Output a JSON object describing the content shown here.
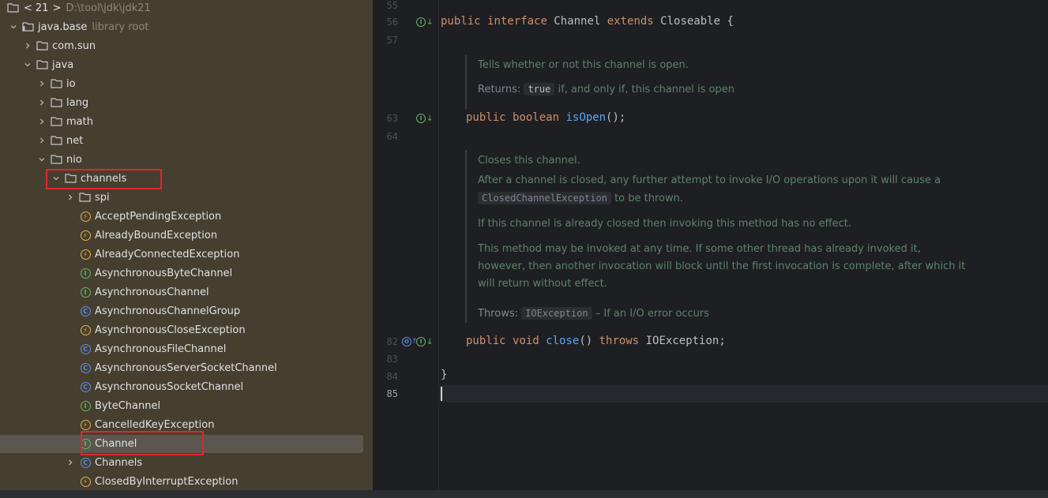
{
  "project_tree": {
    "header": {
      "back": "<",
      "version": "21",
      "sep": ">",
      "path": "D:\\tool\\jdk\\jdk21"
    },
    "nodes": [
      {
        "label": "java.base",
        "hint": "library root",
        "kind": "library"
      },
      {
        "label": "com.sun",
        "kind": "package"
      },
      {
        "label": "java",
        "kind": "package"
      },
      {
        "label": "io",
        "kind": "package"
      },
      {
        "label": "lang",
        "kind": "package"
      },
      {
        "label": "math",
        "kind": "package"
      },
      {
        "label": "net",
        "kind": "package"
      },
      {
        "label": "nio",
        "kind": "package"
      },
      {
        "label": "channels",
        "kind": "package",
        "highlighted": true
      },
      {
        "label": "spi",
        "kind": "package"
      },
      {
        "label": "AcceptPendingException",
        "kind": "exception"
      },
      {
        "label": "AlreadyBoundException",
        "kind": "exception"
      },
      {
        "label": "AlreadyConnectedException",
        "kind": "exception"
      },
      {
        "label": "AsynchronousByteChannel",
        "kind": "interface"
      },
      {
        "label": "AsynchronousChannel",
        "kind": "interface"
      },
      {
        "label": "AsynchronousChannelGroup",
        "kind": "class"
      },
      {
        "label": "AsynchronousCloseException",
        "kind": "exception"
      },
      {
        "label": "AsynchronousFileChannel",
        "kind": "class"
      },
      {
        "label": "AsynchronousServerSocketChannel",
        "kind": "class"
      },
      {
        "label": "AsynchronousSocketChannel",
        "kind": "class"
      },
      {
        "label": "ByteChannel",
        "kind": "interface"
      },
      {
        "label": "CancelledKeyException",
        "kind": "exception"
      },
      {
        "label": "Channel",
        "kind": "interface",
        "selected": true,
        "highlighted": true
      },
      {
        "label": "Channels",
        "kind": "class"
      },
      {
        "label": "ClosedByInterruptException",
        "kind": "exception"
      }
    ]
  },
  "editor": {
    "line_numbers": [
      "55",
      "56",
      "57",
      "63",
      "64",
      "82",
      "83",
      "84",
      "85"
    ],
    "code": {
      "l56_kw1": "public",
      "l56_kw2": "interface",
      "l56_name": " Channel ",
      "l56_kw3": "extends",
      "l56_rest": " Closeable {",
      "l63_kw1": "public",
      "l63_kw2": "boolean",
      "l63_fn": "isOpen",
      "l63_rest": "();",
      "l82_kw1": "public",
      "l82_kw2": "void",
      "l82_fn": "close",
      "l82_mid": "() ",
      "l82_kw3": "throws",
      "l82_rest": " IOException;",
      "l84": "}"
    },
    "doc_isopen": {
      "summary": "Tells whether or not this channel is open.",
      "returns_label": "Returns:",
      "returns_code": "true",
      "returns_text": " if, and only if, this channel is open"
    },
    "doc_close": {
      "summary": "Closes this channel.",
      "p1_text": "After a channel is closed, any further attempt to invoke I/O operations upon it will cause a",
      "p1_code": "ClosedChannelException",
      "p1_tail": " to be thrown.",
      "p2": "If this channel is already closed then invoking this method has no effect.",
      "p3": "This method may be invoked at any time. If some other thread has already invoked it, however, then another invocation will block until the first invocation is complete, after which it will return without effect.",
      "throws_label": "Throws:",
      "throws_code": "IOException",
      "throws_text": " – If an I/O error occurs"
    }
  },
  "colors": {
    "sidebar_bg": "#463f2f",
    "editor_bg": "#1e1f22",
    "keyword": "#cf8e6d",
    "function": "#56a8f5",
    "doc_text": "#5f826b",
    "highlight_box": "#e0262e"
  }
}
